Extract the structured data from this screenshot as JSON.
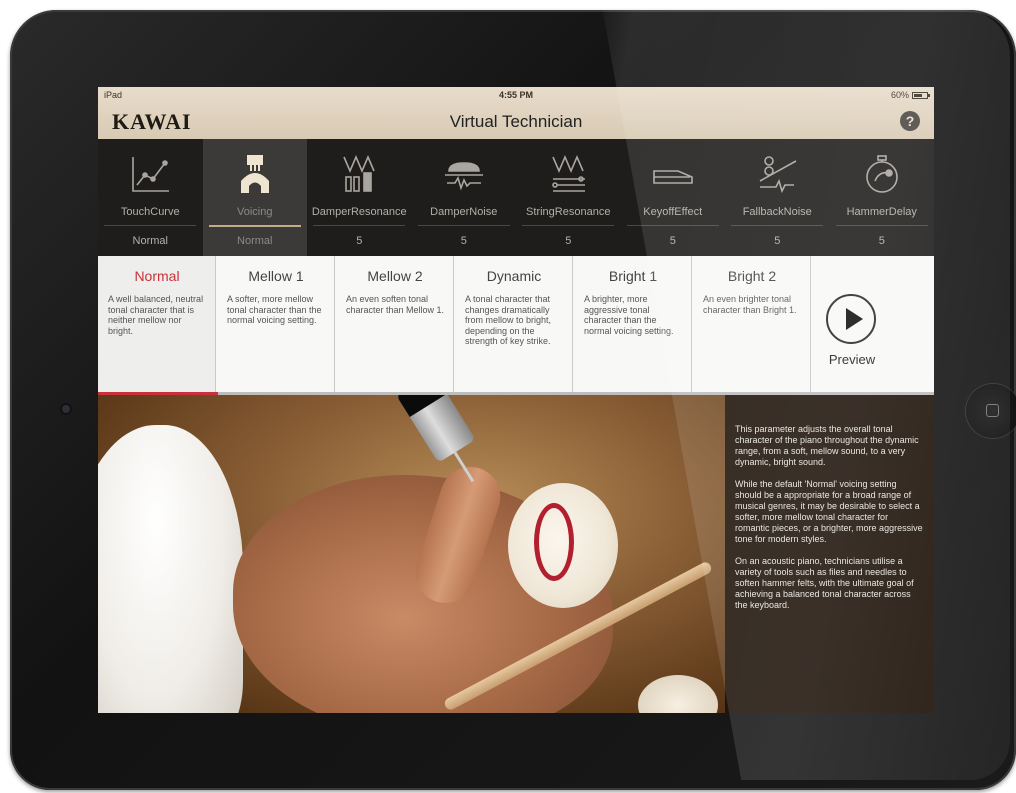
{
  "status_bar": {
    "device": "iPad",
    "time": "4:55 PM",
    "battery": "60%"
  },
  "header": {
    "brand": "KAWAI",
    "title": "Virtual Technician",
    "help": "?"
  },
  "tabs": [
    {
      "label": "TouchCurve",
      "value": "Normal",
      "icon": "touch-curve-icon"
    },
    {
      "label": "Voicing",
      "value": "Normal",
      "icon": "voicing-hammer-icon",
      "active": true
    },
    {
      "label": "DamperResonance",
      "value": "5",
      "icon": "damper-resonance-icon"
    },
    {
      "label": "DamperNoise",
      "value": "5",
      "icon": "damper-noise-icon"
    },
    {
      "label": "StringResonance",
      "value": "5",
      "icon": "string-resonance-icon"
    },
    {
      "label": "KeyoffEffect",
      "value": "5",
      "icon": "keyoff-effect-icon"
    },
    {
      "label": "FallbackNoise",
      "value": "5",
      "icon": "fallback-noise-icon"
    },
    {
      "label": "HammerDelay",
      "value": "5",
      "icon": "hammer-delay-icon"
    }
  ],
  "options": [
    {
      "title": "Normal",
      "desc": "A well balanced, neutral tonal character that is neither mellow nor bright.",
      "selected": true
    },
    {
      "title": "Mellow 1",
      "desc": "A softer, more mellow tonal character than the normal voicing setting."
    },
    {
      "title": "Mellow 2",
      "desc": "An even soften tonal character than Mellow 1."
    },
    {
      "title": "Dynamic",
      "desc": "A tonal character that changes dramatically from mellow to bright, depending on the strength of key strike."
    },
    {
      "title": "Bright 1",
      "desc": "A brighter, more aggressive tonal character than the normal voicing setting."
    },
    {
      "title": "Bright 2",
      "desc": "An even brighter tonal character than Bright 1."
    }
  ],
  "option_progress": 0.143,
  "preview": {
    "label": "Preview",
    "icon": "play-icon"
  },
  "info": {
    "paragraphs": [
      "This parameter adjusts the overall tonal character of the piano throughout the dynamic range, from a soft, mellow sound, to a very dynamic, bright sound.",
      "While the default 'Normal' voicing setting should be a appropriate for a broad range of musical genres, it may be desirable to select a softer, more mellow tonal character for romantic pieces, or a brighter, more aggressive tone for modern styles.",
      "On an acoustic piano, technicians utilise a variety of tools such as files and needles to soften hammer felts, with the ultimate goal of achieving a balanced tonal character across the keyboard."
    ]
  },
  "colors": {
    "accent": "#c8313a",
    "header_bg": "#e0d3bf",
    "tabbar_bg": "#1f1d1b",
    "info_bg": "#22160c"
  }
}
